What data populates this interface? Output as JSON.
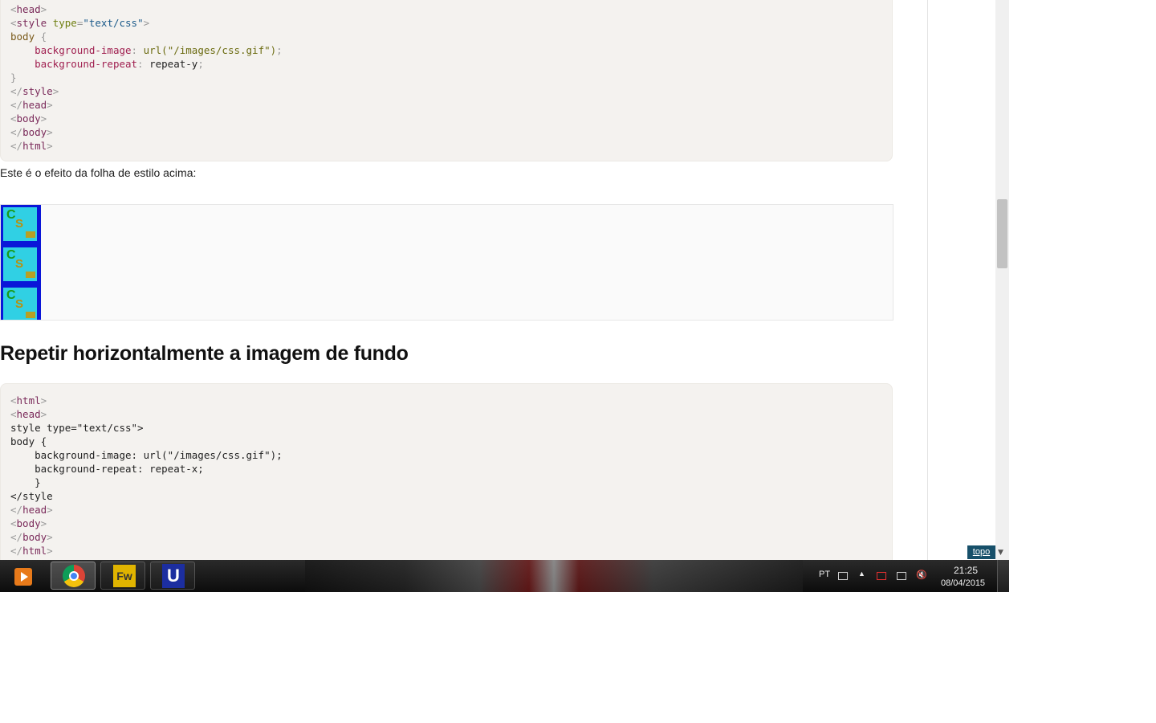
{
  "code1": {
    "lines": [
      "<head>",
      "<style type=\"text/css\">",
      "body {",
      "    background-image: url(\"/images/css.gif\");",
      "    background-repeat: repeat-y;",
      "}",
      "</style>",
      "</head>",
      "<body>",
      "</body>",
      "</html>"
    ]
  },
  "paragraph": "Este é o efeito da folha de estilo acima:",
  "demo": {
    "tile_letters": [
      "C",
      "S"
    ]
  },
  "heading": "Repetir horizontalmente a imagem de fundo",
  "code2": {
    "lines": [
      "<html>",
      "<head>",
      "style type=\"text/css\">",
      "body {",
      "    background-image: url(\"/images/css.gif\");",
      "    background-repeat: repeat-x;",
      "    }",
      "</style",
      "</head>",
      "<body>",
      "</body>",
      "</html>"
    ]
  },
  "topo_link": "topo",
  "taskbar": {
    "apps": [
      "windows-media-player",
      "google-chrome",
      "adobe-fireworks",
      "generic-u-app"
    ],
    "language": "PT",
    "time": "21:25",
    "date": "08/04/2015"
  },
  "colors": {
    "code_bg": "#f4f2ef",
    "demo_blue": "#0a16d8",
    "topo_bg": "#17506a"
  }
}
